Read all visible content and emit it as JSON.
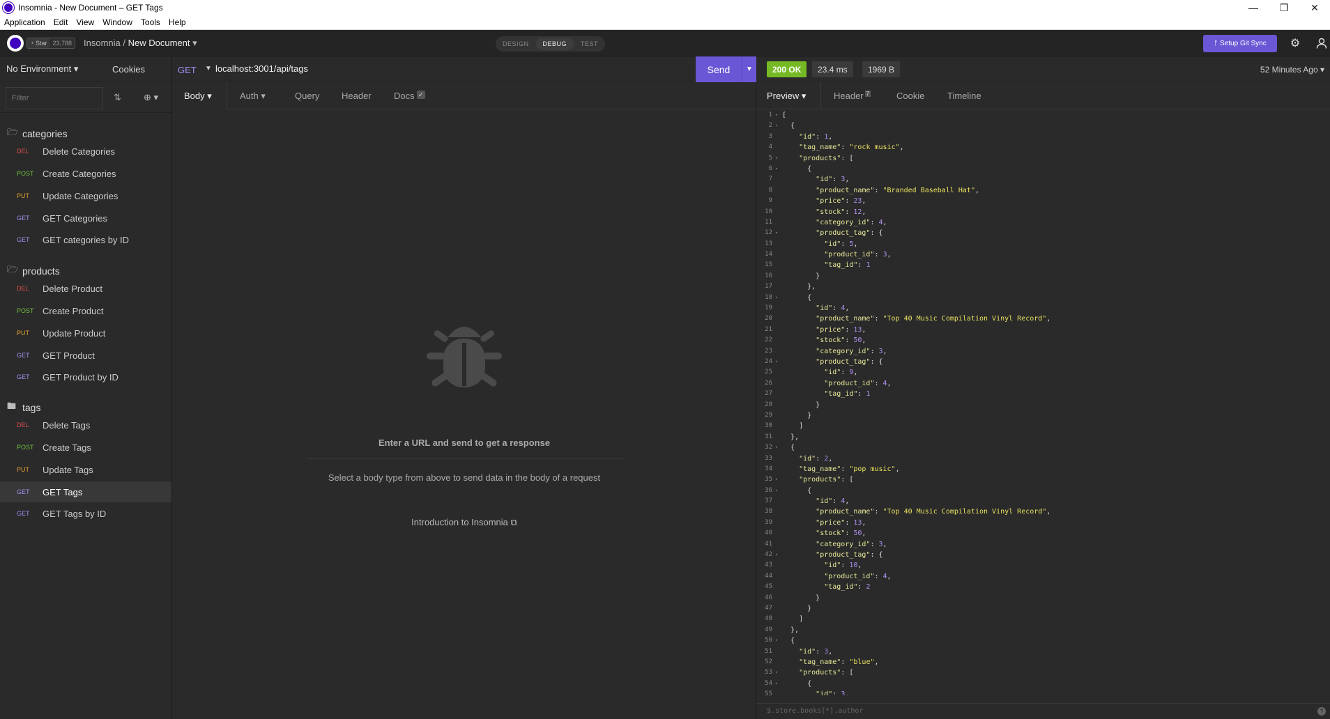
{
  "window": {
    "title": "Insomnia - New Document – GET Tags",
    "controls": [
      "—",
      "❐",
      "✕"
    ]
  },
  "menu": [
    "Application",
    "Edit",
    "View",
    "Window",
    "Tools",
    "Help"
  ],
  "header": {
    "star_label": "Star",
    "star_count": "23,788",
    "workspace": "Insomnia",
    "separator": "/",
    "document": "New Document",
    "modes": [
      "DESIGN",
      "DEBUG",
      "TEST"
    ],
    "active_mode": "DEBUG",
    "git_sync_label": "Setup Git Sync"
  },
  "sidebar": {
    "environment": "No Environment",
    "cookies": "Cookies",
    "filter_placeholder": "Filter",
    "folders": [
      {
        "name": "categories",
        "requests": [
          {
            "method": "DEL",
            "label": "Delete Categories"
          },
          {
            "method": "POST",
            "label": "Create Categories"
          },
          {
            "method": "PUT",
            "label": "Update Categories"
          },
          {
            "method": "GET",
            "label": "GET Categories"
          },
          {
            "method": "GET",
            "label": "GET categories by ID"
          }
        ]
      },
      {
        "name": "products",
        "requests": [
          {
            "method": "DEL",
            "label": "Delete Product"
          },
          {
            "method": "POST",
            "label": "Create Product"
          },
          {
            "method": "PUT",
            "label": "Update Product"
          },
          {
            "method": "GET",
            "label": "GET Product"
          },
          {
            "method": "GET",
            "label": "GET Product by ID"
          }
        ]
      },
      {
        "name": "tags",
        "requests": [
          {
            "method": "DEL",
            "label": "Delete Tags"
          },
          {
            "method": "POST",
            "label": "Create Tags"
          },
          {
            "method": "PUT",
            "label": "Update Tags"
          },
          {
            "method": "GET",
            "label": "GET Tags"
          },
          {
            "method": "GET",
            "label": "GET Tags by ID"
          }
        ]
      }
    ],
    "active_request": "GET Tags"
  },
  "request": {
    "method": "GET",
    "url": "localhost:3001/api/tags",
    "send_label": "Send",
    "tabs": [
      "Body",
      "Auth",
      "Query",
      "Header",
      "Docs"
    ],
    "active_tab": "Body",
    "empty_title": "Enter a URL and send to get a response",
    "empty_hint": "Select a body type from above to send data in the body of a request",
    "intro_link": "Introduction to Insomnia"
  },
  "response": {
    "status": "200 OK",
    "time": "23.4 ms",
    "size": "1969 B",
    "ago": "52 Minutes Ago",
    "tabs": [
      "Preview",
      "Header",
      "Cookie",
      "Timeline"
    ],
    "active_tab": "Preview",
    "header_count": "7",
    "filter_placeholder": "$.store.books[*].author",
    "help": "?"
  },
  "code_lines": [
    "[",
    "  {",
    "    \"id\": 1,",
    "    \"tag_name\": \"rock music\",",
    "    \"products\": [",
    "      {",
    "        \"id\": 3,",
    "        \"product_name\": \"Branded Baseball Hat\",",
    "        \"price\": 23,",
    "        \"stock\": 12,",
    "        \"category_id\": 4,",
    "        \"product_tag\": {",
    "          \"id\": 5,",
    "          \"product_id\": 3,",
    "          \"tag_id\": 1",
    "        }",
    "      },",
    "      {",
    "        \"id\": 4,",
    "        \"product_name\": \"Top 40 Music Compilation Vinyl Record\",",
    "        \"price\": 13,",
    "        \"stock\": 50,",
    "        \"category_id\": 3,",
    "        \"product_tag\": {",
    "          \"id\": 9,",
    "          \"product_id\": 4,",
    "          \"tag_id\": 1",
    "        }",
    "      }",
    "    ]",
    "  },",
    "  {",
    "    \"id\": 2,",
    "    \"tag_name\": \"pop music\",",
    "    \"products\": [",
    "      {",
    "        \"id\": 4,",
    "        \"product_name\": \"Top 40 Music Compilation Vinyl Record\",",
    "        \"price\": 13,",
    "        \"stock\": 50,",
    "        \"category_id\": 3,",
    "        \"product_tag\": {",
    "          \"id\": 10,",
    "          \"product_id\": 4,",
    "          \"tag_id\": 2",
    "        }",
    "      }",
    "    ]",
    "  },",
    "  {",
    "    \"id\": 3,",
    "    \"tag_name\": \"blue\",",
    "    \"products\": [",
    "      {",
    "        \"id\": 3,"
  ],
  "fold_lines": [
    1,
    2,
    5,
    6,
    12,
    18,
    24,
    32,
    35,
    36,
    42,
    50,
    53,
    54
  ]
}
